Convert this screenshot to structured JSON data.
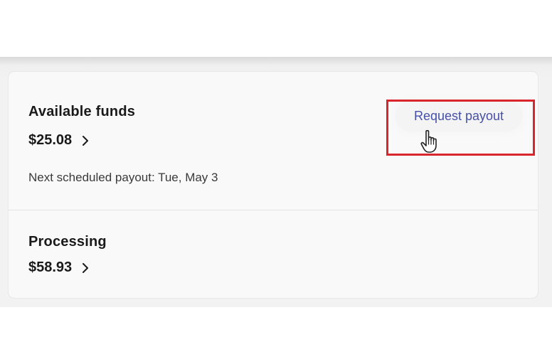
{
  "available": {
    "label": "Available funds",
    "amount": "$25.08",
    "next_payout": "Next scheduled payout: Tue, May 3",
    "request_button": "Request payout"
  },
  "processing": {
    "label": "Processing",
    "amount": "$58.93"
  },
  "colors": {
    "link": "#4650a6",
    "highlight": "#d9252c",
    "card_bg": "#f9f9f9",
    "page_band": "#f2f2f2"
  },
  "icons": {
    "chevron": "chevron-right-icon",
    "cursor": "hand-pointer-cursor-icon"
  }
}
